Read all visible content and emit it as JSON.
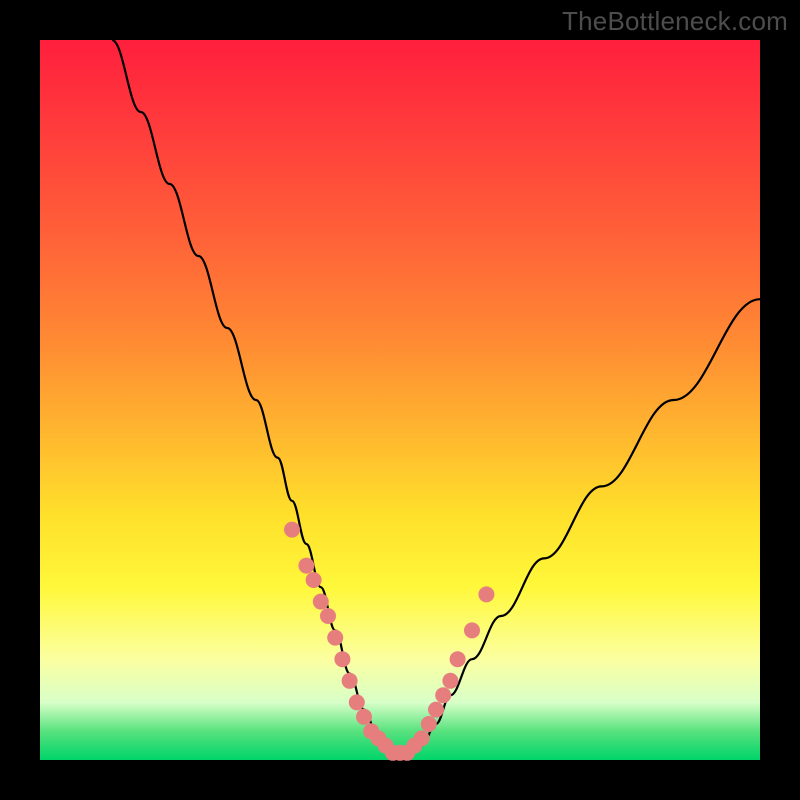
{
  "watermark": "TheBottleneck.com",
  "chart_data": {
    "type": "line",
    "title": "",
    "xlabel": "",
    "ylabel": "",
    "xlim": [
      0,
      100
    ],
    "ylim": [
      0,
      100
    ],
    "grid": false,
    "series": [
      {
        "name": "bottleneck-curve",
        "x": [
          10,
          14,
          18,
          22,
          26,
          30,
          33,
          35,
          37,
          39,
          41,
          43,
          45,
          47,
          49,
          51,
          53,
          55,
          57,
          60,
          64,
          70,
          78,
          88,
          100
        ],
        "y": [
          100,
          90,
          80,
          70,
          60,
          50,
          42,
          36,
          30,
          24,
          18,
          12,
          7,
          3,
          1,
          1,
          2,
          5,
          9,
          14,
          20,
          28,
          38,
          50,
          64
        ]
      }
    ],
    "markers": {
      "name": "highlight-points",
      "comment": "salmon dots clustered near the valley bottom on both arms",
      "x": [
        35,
        37,
        38,
        39,
        40,
        41,
        42,
        43,
        44,
        45,
        46,
        47,
        48,
        49,
        50,
        51,
        52,
        53,
        54,
        55,
        56,
        57,
        58,
        60,
        62
      ],
      "y": [
        32,
        27,
        25,
        22,
        20,
        17,
        14,
        11,
        8,
        6,
        4,
        3,
        2,
        1,
        1,
        1,
        2,
        3,
        5,
        7,
        9,
        11,
        14,
        18,
        23
      ]
    },
    "colors": {
      "curve": "#000000",
      "marker": "#e77e7e",
      "gradient_top": "#ff1f3d",
      "gradient_bottom": "#00d46a"
    }
  }
}
